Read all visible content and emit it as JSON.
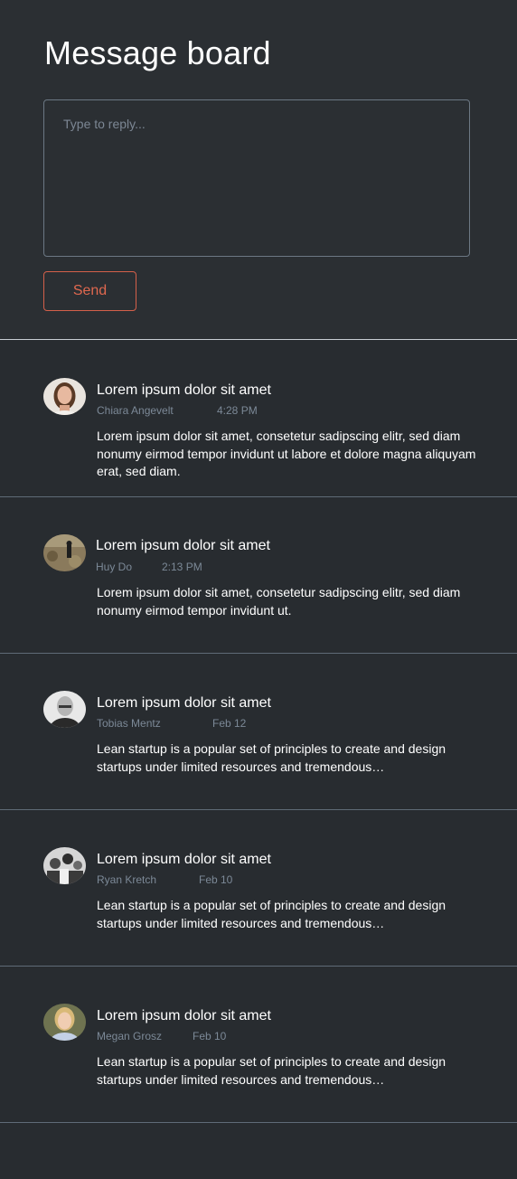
{
  "header": {
    "title": "Message board"
  },
  "reply": {
    "placeholder": "Type to reply...",
    "send_label": "Send"
  },
  "colors": {
    "accent": "#e0684f",
    "muted": "#7c8997",
    "background": "#282c30"
  },
  "messages": [
    {
      "title": "Lorem ipsum dolor sit amet",
      "author": "Chiara Angevelt",
      "time": "4:28 PM",
      "body": "Lorem ipsum dolor sit amet, consetetur sadipscing elitr, sed diam nonumy eirmod tempor invidunt ut labore et dolore magna aliquyam erat, sed diam.",
      "avatar": "woman-brown-hair-avatar"
    },
    {
      "title": "Lorem ipsum dolor sit amet",
      "author": "Huy Do",
      "time": "2:13 PM",
      "body": "Lorem ipsum dolor sit amet, consetetur sadipscing elitr, sed diam nonumy eirmod tempor invidunt ut.",
      "avatar": "person-on-field-avatar"
    },
    {
      "title": "Lorem ipsum dolor sit amet",
      "author": "Tobias Mentz",
      "time": "Feb 12",
      "body": "Lean startup is a popular set of principles to create and design startups under limited resources and tremendous…",
      "avatar": "bald-man-bw-avatar"
    },
    {
      "title": "Lorem ipsum dolor sit amet",
      "author": "Ryan Kretch",
      "time": "Feb 10",
      "body": "Lean startup is a popular set of principles to create and design startups under limited resources and tremendous…",
      "avatar": "group-bw-avatar"
    },
    {
      "title": "Lorem ipsum dolor sit amet",
      "author": "Megan Grosz",
      "time": "Feb 10",
      "body": "Lean startup is a popular set of principles to create and design startups under limited resources and tremendous…",
      "avatar": "blonde-woman-avatar"
    }
  ]
}
